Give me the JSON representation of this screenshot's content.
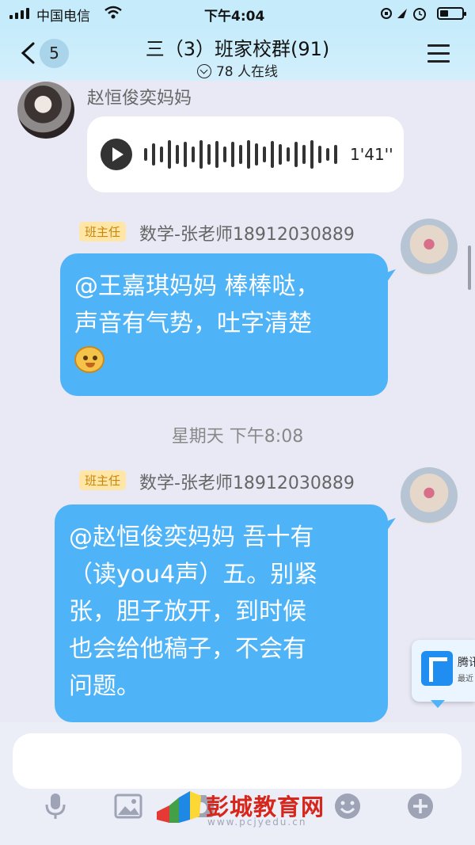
{
  "status_bar": {
    "carrier": "中国电信",
    "time": "下午4:04"
  },
  "header": {
    "back_badge": "5",
    "title": "三（3）班家校群(91)",
    "online": "78 人在线"
  },
  "messages": [
    {
      "type": "voice",
      "sender": "赵恒俊奕妈妈",
      "duration": "1'41''"
    },
    {
      "type": "text",
      "role_tag": "班主任",
      "sender": "数学-张老师18912030889",
      "lines": [
        "@王嘉琪妈妈 棒棒哒，",
        "声音有气势，吐字清楚"
      ],
      "emoji": "smiley-emoji"
    },
    {
      "type": "timestamp",
      "text": "星期天 下午8:08"
    },
    {
      "type": "text",
      "role_tag": "班主任",
      "sender": "数学-张老师18912030889",
      "lines": [
        "@赵恒俊奕妈妈 吾十有",
        "（读you4声）五。别紧",
        "张，胆子放开，到时候",
        "也会给他稿子，不会有",
        "问题。"
      ]
    }
  ],
  "floating_widget": {
    "title": "腾讯",
    "subtitle": "最近"
  },
  "input_bar": {
    "placeholder": "",
    "tools": [
      "mic-icon",
      "image-icon",
      "camera-icon",
      "emoji-icon",
      "plus-icon"
    ]
  },
  "watermark": {
    "text": "彭城教育网",
    "url": "www.pcjyedu.cn"
  },
  "colors": {
    "bubble_blue": "#4fb3f7",
    "header_bg": "#c6ecfb",
    "tag_text": "#c8860a"
  }
}
